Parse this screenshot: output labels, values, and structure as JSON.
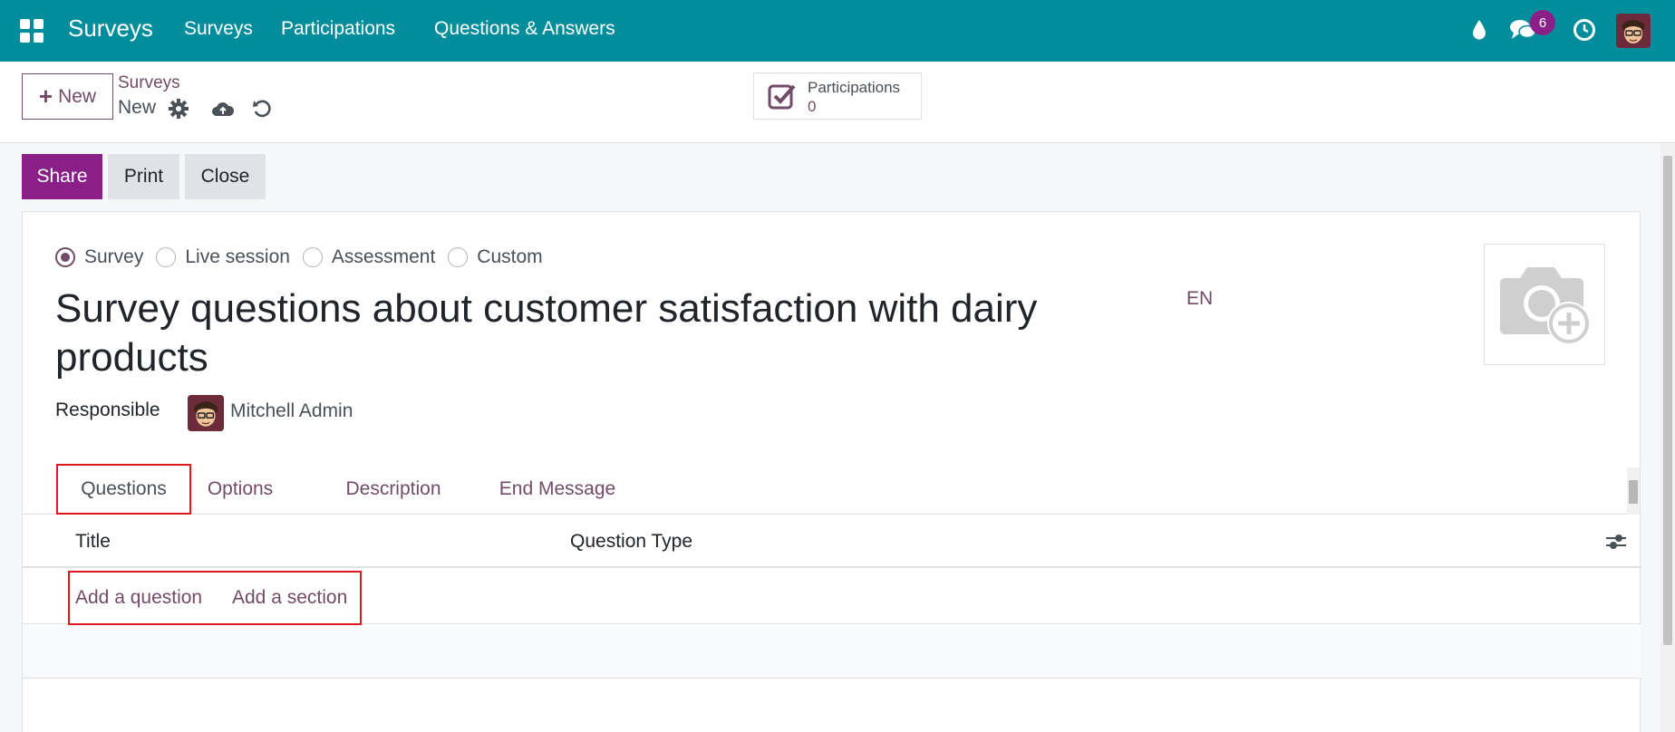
{
  "navbar": {
    "brand": "Surveys",
    "menu": [
      "Surveys",
      "Participations",
      "Questions & Answers"
    ],
    "chat_badge": "6",
    "icons": [
      "apps-icon",
      "droplet-icon",
      "chat-icon",
      "clock-icon",
      "user-avatar"
    ]
  },
  "control_panel": {
    "new_label": "New",
    "breadcrumb_parent": "Surveys",
    "breadcrumb_current": "New",
    "stat_label": "Participations",
    "stat_value": "0",
    "icons": [
      "gear-icon",
      "cloud-upload-icon",
      "undo-icon"
    ]
  },
  "actions": {
    "share": "Share",
    "print": "Print",
    "close": "Close"
  },
  "form": {
    "survey_types": [
      "Survey",
      "Live session",
      "Assessment",
      "Custom"
    ],
    "selected_type": "Survey",
    "title": "Survey questions about customer satisfaction with dairy products",
    "lang": "EN",
    "responsible_label": "Responsible",
    "responsible_name": "Mitchell Admin"
  },
  "tabs": [
    "Questions",
    "Options",
    "Description",
    "End Message"
  ],
  "active_tab": "Questions",
  "table": {
    "columns": [
      "Title",
      "Question Type"
    ],
    "add_question": "Add a question",
    "add_section": "Add a section"
  },
  "colors": {
    "navbar": "#018d9b",
    "primary": "#8a1f87",
    "link": "#714b67",
    "highlight": "#e0191d"
  }
}
